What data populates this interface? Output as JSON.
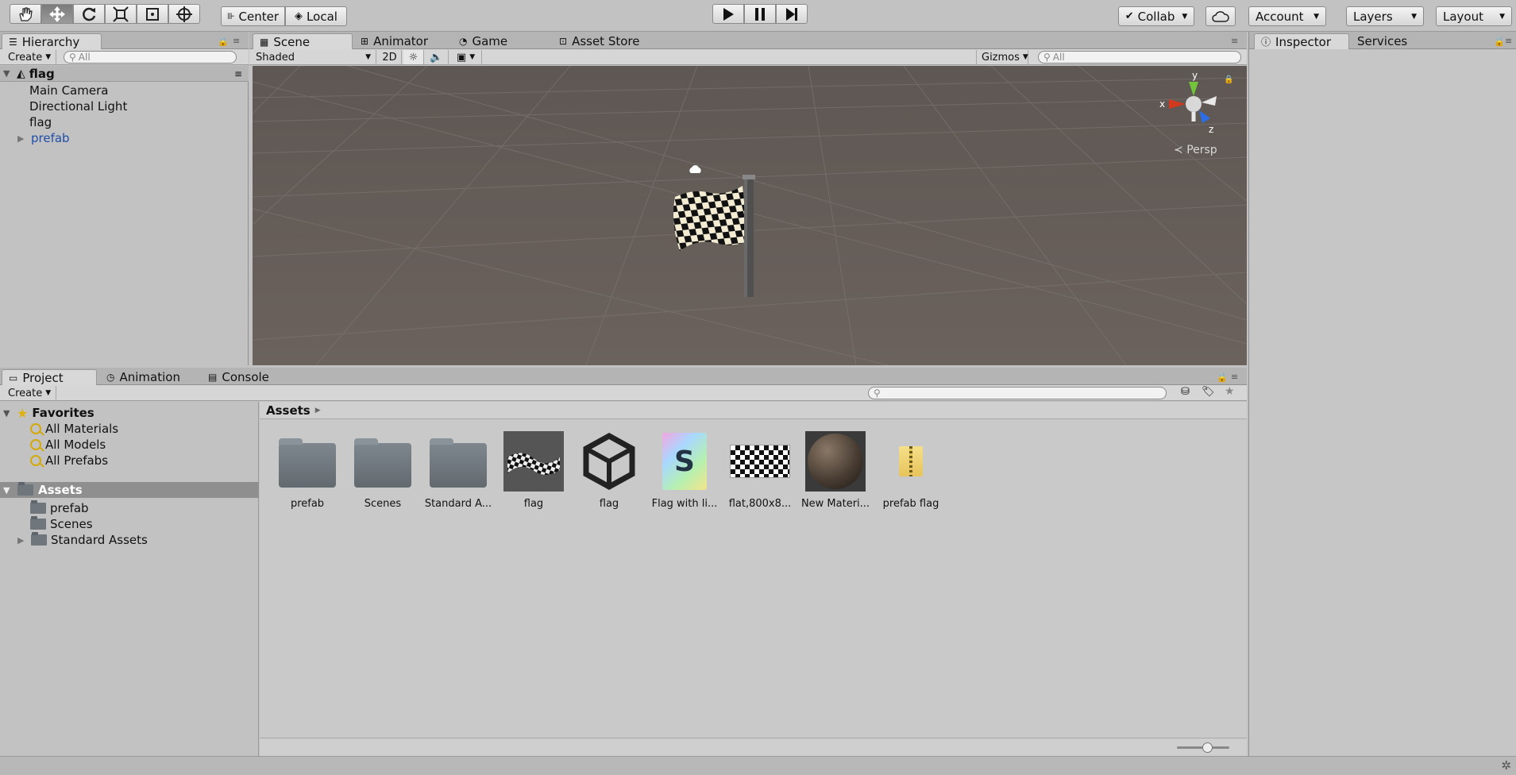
{
  "toolbar": {
    "tools": [
      "hand-tool",
      "move-tool",
      "rotate-tool",
      "scale-tool",
      "rect-tool",
      "transform-tool"
    ],
    "center_label": "Center",
    "local_label": "Local",
    "collab_label": "Collab",
    "account_label": "Account",
    "layers_label": "Layers",
    "layout_label": "Layout"
  },
  "hierarchy": {
    "tab_label": "Hierarchy",
    "create_label": "Create",
    "search_placeholder": "All",
    "scene_name": "flag",
    "items": [
      {
        "label": "Main Camera"
      },
      {
        "label": "Directional Light"
      },
      {
        "label": "flag"
      },
      {
        "label": "prefab"
      }
    ]
  },
  "scene_view": {
    "tabs": [
      {
        "label": "Scene"
      },
      {
        "label": "Animator"
      },
      {
        "label": "Game"
      },
      {
        "label": "Asset Store"
      }
    ],
    "shading_label": "Shaded",
    "mode_2d_label": "2D",
    "gizmos_label": "Gizmos",
    "search_placeholder": "All",
    "gizmo_axes": {
      "x": "x",
      "y": "y",
      "z": "z"
    },
    "projection_label": "Persp"
  },
  "inspector": {
    "tabs": [
      {
        "label": "Inspector"
      },
      {
        "label": "Services"
      }
    ]
  },
  "project": {
    "tabs": [
      {
        "label": "Project"
      },
      {
        "label": "Animation"
      },
      {
        "label": "Console"
      }
    ],
    "create_label": "Create",
    "favorites_label": "Favorites",
    "favorites": [
      {
        "label": "All Materials"
      },
      {
        "label": "All Models"
      },
      {
        "label": "All Prefabs"
      }
    ],
    "assets_root_label": "Assets",
    "asset_folders": [
      {
        "label": "prefab"
      },
      {
        "label": "Scenes"
      },
      {
        "label": "Standard Assets"
      }
    ],
    "breadcrumb": "Assets",
    "grid_items": [
      {
        "label": "prefab",
        "kind": "folder"
      },
      {
        "label": "Scenes",
        "kind": "folder"
      },
      {
        "label": "Standard A...",
        "kind": "folder"
      },
      {
        "label": "flag",
        "kind": "model"
      },
      {
        "label": "flag",
        "kind": "unity-scene"
      },
      {
        "label": "Flag with li...",
        "kind": "shader"
      },
      {
        "label": "flat,800x8...",
        "kind": "texture"
      },
      {
        "label": "New Materi...",
        "kind": "material"
      },
      {
        "label": "prefab flag",
        "kind": "zip"
      }
    ]
  },
  "colors": {
    "accent_blue": "#1f4ea8",
    "scene_bg": "#655d59",
    "panel": "#c2c2c2"
  }
}
